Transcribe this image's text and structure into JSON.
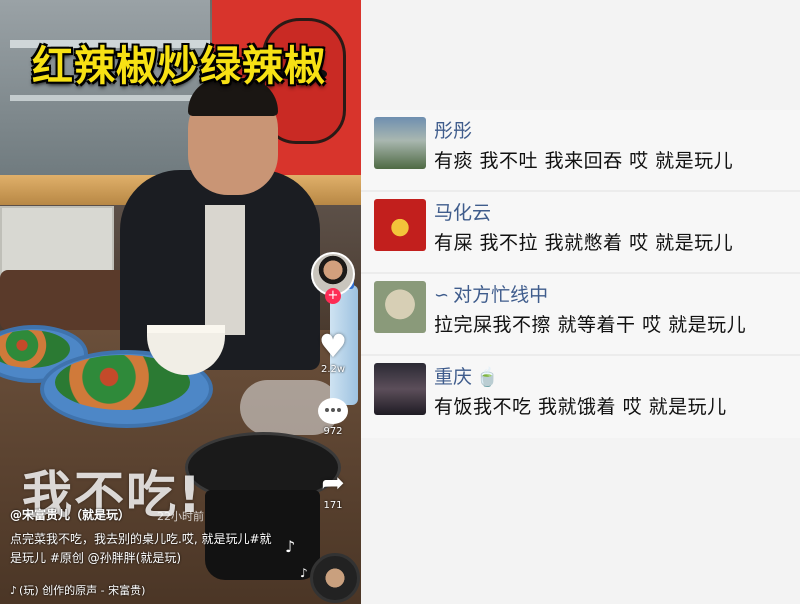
{
  "video": {
    "title_overlay": "红辣椒炒绿辣椒",
    "caption_overlay": "我不吃!",
    "author": "@宋富贵儿（就是玩）",
    "post_time": "22小时前",
    "description": "点完菜我不吃，我去别的桌儿吃.哎, 就是玩儿#就是玩儿 #原创 @孙胖胖(就是玩)",
    "music": "(玩) 创作的原声 - 宋富贵)",
    "likes": "2.2w",
    "comments": "972",
    "shares": "171",
    "icons": {
      "follow": "plus-icon",
      "like": "heart-icon",
      "comment": "comment-bubble-icon",
      "share": "share-arrow-icon",
      "music": "music-note-icon"
    }
  },
  "comments": [
    {
      "name": "彤彤",
      "text": "有痰 我不吐 我来回吞 哎 就是玩儿"
    },
    {
      "name": "马化云",
      "text": "有屎 我不拉 我就憋着 哎 就是玩儿"
    },
    {
      "name": "对方忙线中",
      "text": "拉完屎我不擦 就等着干 哎 就是玩儿"
    },
    {
      "name": "重庆",
      "text": "有饭我不吃 我就饿着 哎 就是玩儿"
    }
  ],
  "colors": {
    "title_overlay": "#f7e114",
    "username": "#3f5c8c",
    "follow_badge": "#fe2c55"
  }
}
